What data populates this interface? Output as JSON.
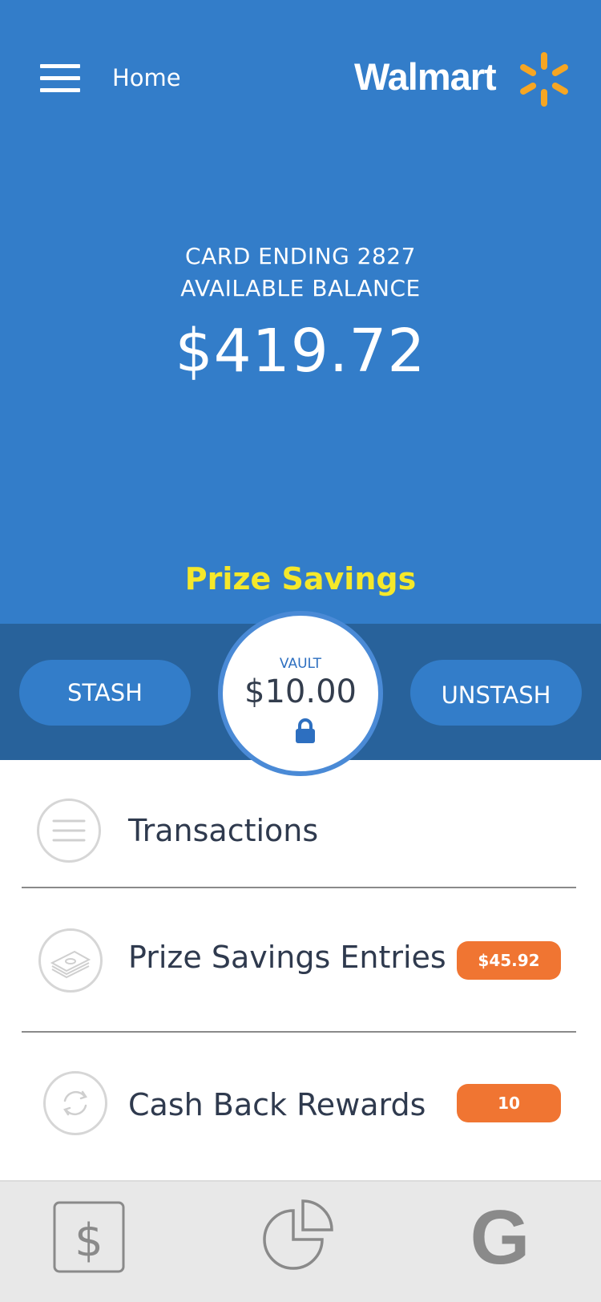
{
  "header": {
    "nav_title": "Home",
    "brand_name": "Walmart",
    "brand_color": "#337dc9",
    "spark_color": "#f6a623"
  },
  "balance": {
    "card_line": "CARD ENDING 2827",
    "label": "AVAILABLE BALANCE",
    "amount": "$419.72"
  },
  "prize_savings": {
    "title": "Prize Savings",
    "stash_label": "STASH",
    "unstash_label": "UNSTASH",
    "vault_label": "VAULT",
    "vault_amount": "$10.00"
  },
  "list": [
    {
      "label": "Transactions",
      "icon": "list-icon"
    },
    {
      "label": "Prize Savings Entries",
      "icon": "money-stack-icon",
      "badge": "$45.92"
    },
    {
      "label": "Cash Back Rewards",
      "icon": "refresh-icon",
      "badge": "10"
    }
  ],
  "badge_color": "#f07532",
  "tabs": [
    {
      "icon": "dollar-icon"
    },
    {
      "icon": "pie-chart-icon"
    },
    {
      "icon": "g-logo-icon"
    }
  ]
}
